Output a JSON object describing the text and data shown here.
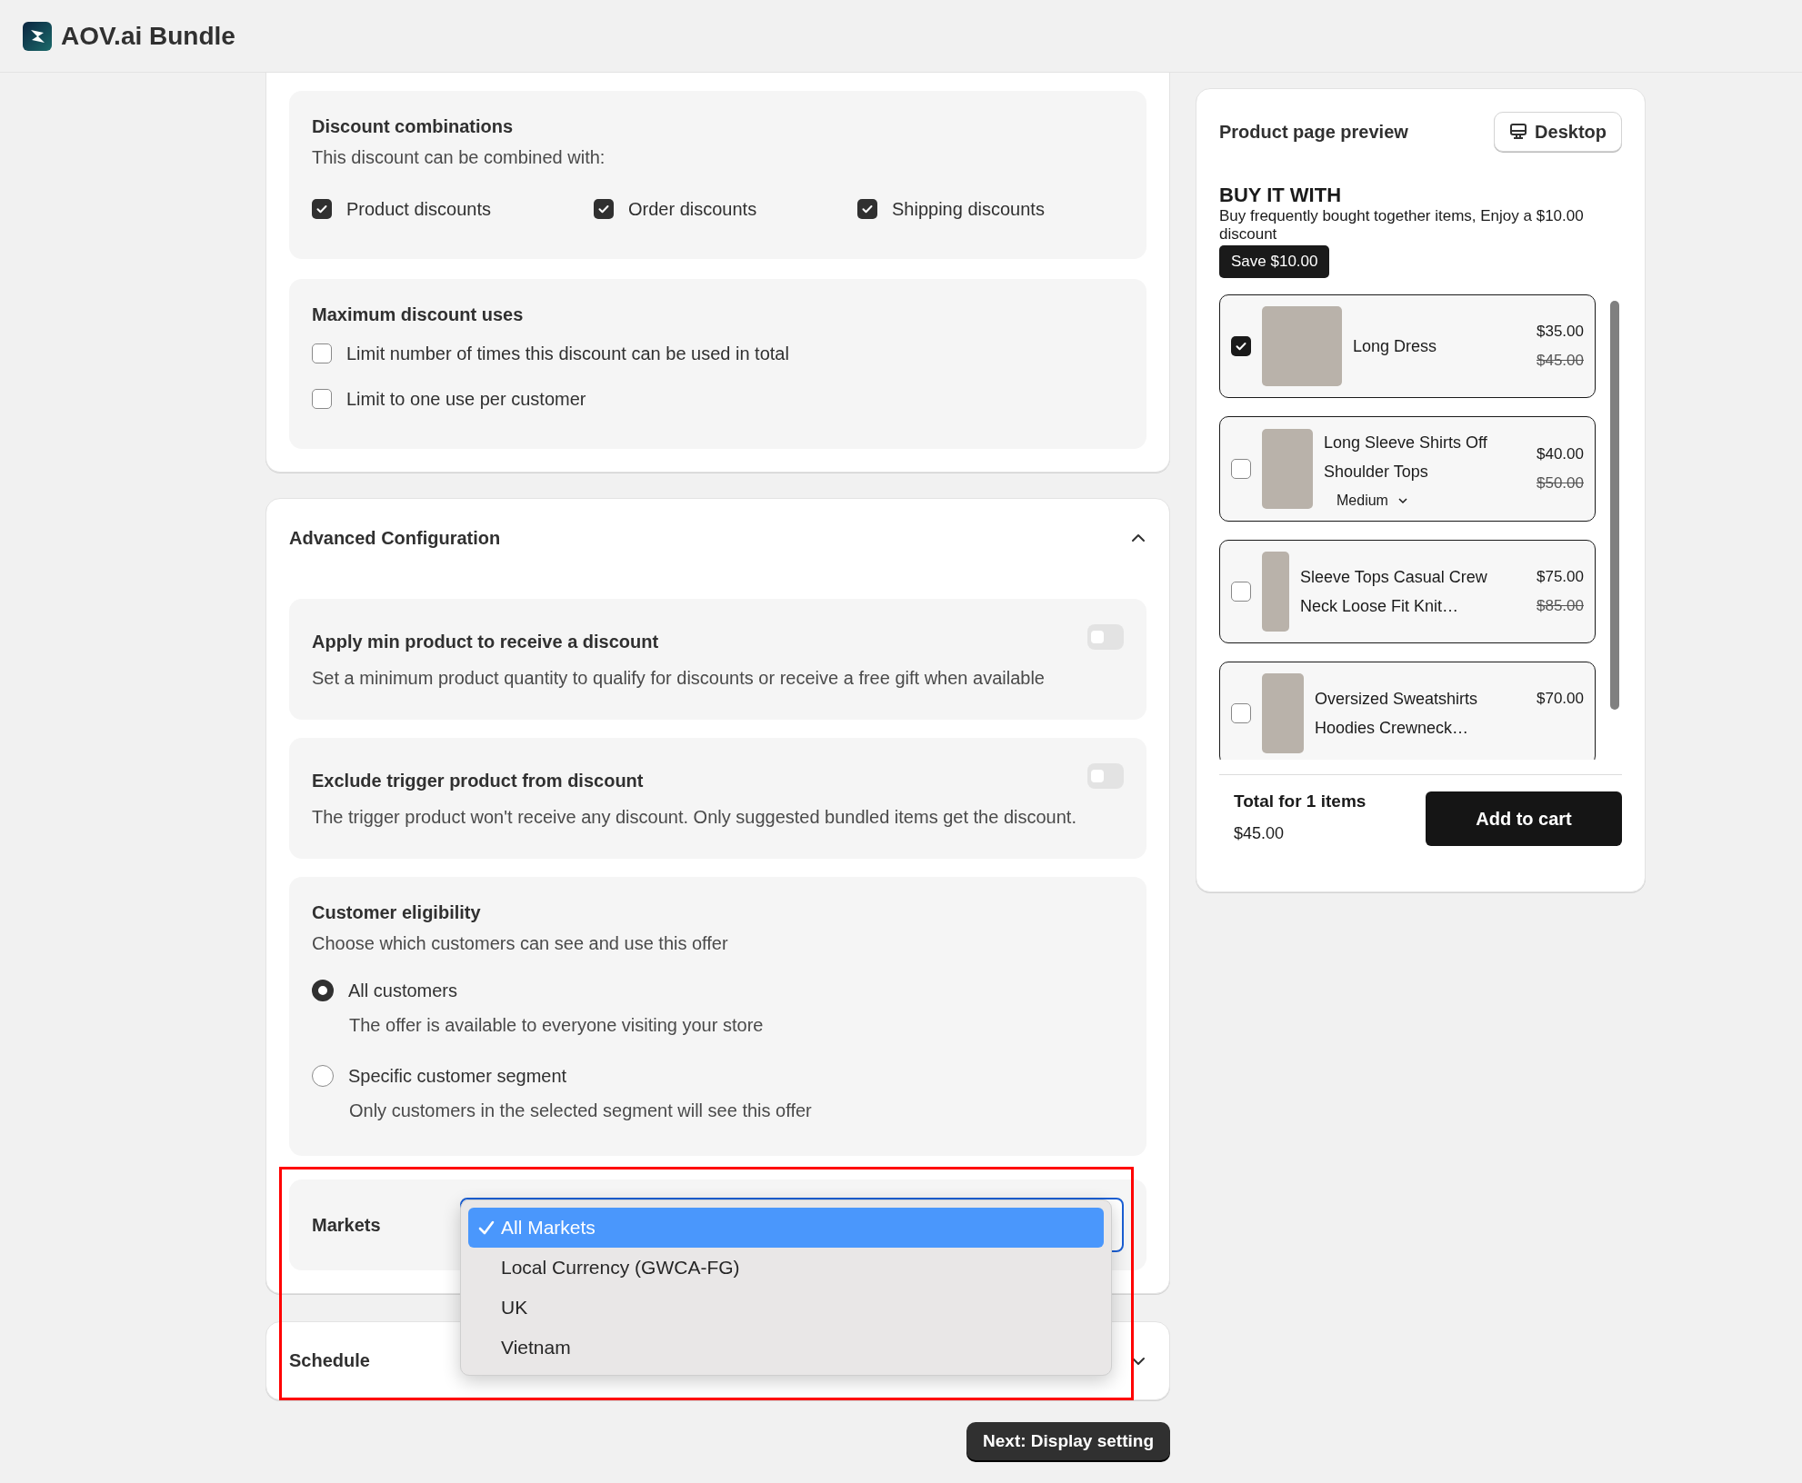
{
  "app": {
    "title": "AOV.ai Bundle"
  },
  "discount_combinations": {
    "title": "Discount combinations",
    "subtitle": "This discount can be combined with:",
    "options": [
      {
        "label": "Product discounts",
        "checked": true
      },
      {
        "label": "Order discounts",
        "checked": true
      },
      {
        "label": "Shipping discounts",
        "checked": true
      }
    ]
  },
  "maximum_discount_uses": {
    "title": "Maximum discount uses",
    "options": [
      {
        "label": "Limit number of times this discount can be used in total",
        "checked": false
      },
      {
        "label": "Limit to one use per customer",
        "checked": false
      }
    ]
  },
  "advanced_configuration": {
    "title": "Advanced Configuration",
    "expanded": true,
    "settings": [
      {
        "title": "Apply min product to receive a discount",
        "description": "Set a minimum product quantity to qualify for discounts or receive a free gift when available",
        "on": false
      },
      {
        "title": "Exclude trigger product from discount",
        "description": "The trigger product won't receive any discount. Only suggested bundled items get the discount.",
        "on": false
      }
    ],
    "customer_eligibility": {
      "title": "Customer eligibility",
      "subtitle": "Choose which customers can see and use this offer",
      "options": [
        {
          "label": "All customers",
          "description": "The offer is available to everyone visiting your store",
          "selected": true
        },
        {
          "label": "Specific customer segment",
          "description": "Only customers in the selected segment will see this offer",
          "selected": false
        }
      ]
    },
    "markets": {
      "label": "Markets",
      "options": [
        {
          "label": "All Markets",
          "selected": true
        },
        {
          "label": "Local Currency (GWCA-FG)",
          "selected": false
        },
        {
          "label": "UK",
          "selected": false
        },
        {
          "label": "Vietnam",
          "selected": false
        }
      ]
    }
  },
  "schedule": {
    "title": "Schedule",
    "expanded": false
  },
  "next_button": "Next: Display setting",
  "preview": {
    "title": "Product page preview",
    "device_button": "Desktop",
    "widget": {
      "heading": "BUY IT WITH",
      "subheading": "Buy frequently bought together items, Enjoy a $10.00 discount",
      "save_badge": "Save $10.00",
      "products": [
        {
          "name": "Long Dress",
          "checked": true,
          "price": "$35.00",
          "compare_price": "$45.00"
        },
        {
          "name": "Long Sleeve Shirts Off Shoulder Tops",
          "checked": false,
          "price": "$40.00",
          "compare_price": "$50.00",
          "variant": "Medium"
        },
        {
          "name": "Sleeve Tops Casual Crew Neck Loose Fit Knit…",
          "checked": false,
          "price": "$75.00",
          "compare_price": "$85.00"
        },
        {
          "name": "Oversized Sweatshirts Hoodies Crewneck…",
          "checked": false,
          "price": "$70.00"
        }
      ],
      "total_label": "Total for 1 items",
      "total": "$45.00",
      "add_to_cart": "Add to cart"
    }
  }
}
